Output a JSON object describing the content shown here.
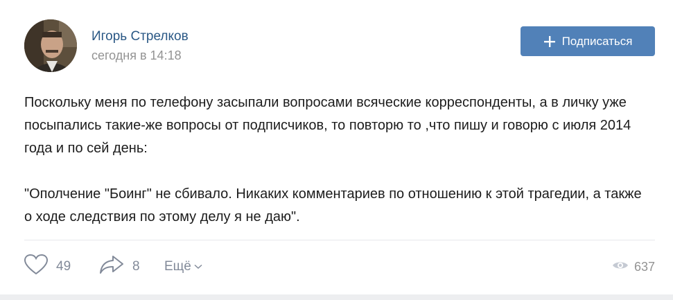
{
  "post": {
    "author": "Игорь Стрелков",
    "timestamp": "сегодня в 14:18",
    "subscribe_label": "Подписаться",
    "paragraphs": [
      "Поскольку меня по телефону засыпали вопросами всяческие корреспонденты, а в личку уже посыпались такие-же вопросы от подписчиков, то повторю то ,что пишу и говорю с июля 2014 года и по сей день:",
      "\"Ополчение \"Боинг\" не сбивало. Никаких комментариев по отношению к этой трагедии, а также о ходе следствия по этому делу я не даю\"."
    ]
  },
  "actions": {
    "likes": "49",
    "shares": "8",
    "more_label": "Ещё",
    "views": "637"
  },
  "icons": {
    "like": "heart-icon",
    "share": "share-arrow-icon",
    "more": "chevron-down-icon",
    "views": "eye-icon",
    "subscribe": "plus-icon"
  },
  "colors": {
    "accent": "#5181b8",
    "author_link": "#2a5885",
    "muted": "#828a99"
  }
}
